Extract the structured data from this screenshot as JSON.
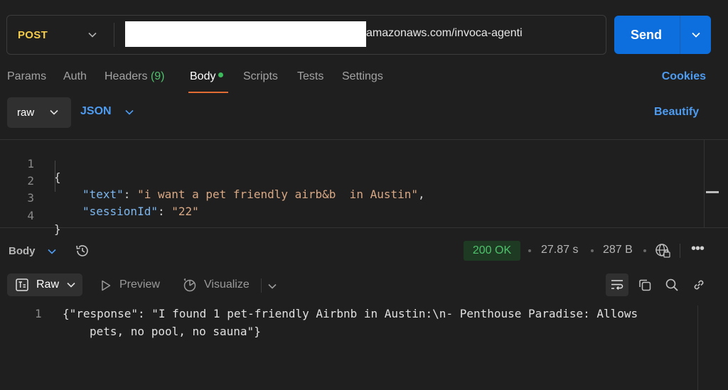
{
  "request": {
    "method": "POST",
    "url_visible": "amazonaws.com/invoca-agenti",
    "send_label": "Send"
  },
  "tabs": [
    {
      "label": "Params"
    },
    {
      "label": "Auth"
    },
    {
      "label": "Headers",
      "count": "(9)"
    },
    {
      "label": "Body",
      "active": true
    },
    {
      "label": "Scripts"
    },
    {
      "label": "Tests"
    },
    {
      "label": "Settings"
    }
  ],
  "cookies_label": "Cookies",
  "body_options": {
    "mode": "raw",
    "language": "JSON",
    "beautify_label": "Beautify"
  },
  "editor": {
    "line_numbers": [
      "1",
      "2",
      "3",
      "4"
    ],
    "open_brace": "{",
    "close_brace": "}",
    "text_key": "\"text\"",
    "text_value": "\"i want a pet friendly airb&b  in Austin\"",
    "session_key": "\"sessionId\"",
    "session_value": "\"22\""
  },
  "response": {
    "section_label": "Body",
    "status": "200 OK",
    "time": "27.87 s",
    "size": "287 B",
    "more_label": "•••",
    "view_mode": "Raw",
    "preview_label": "Preview",
    "visualize_label": "Visualize",
    "line_number": "1",
    "line_1": "{\"response\": \"I found 1 pet-friendly Airbnb in Austin:\\n- Penthouse Paradise: Allows",
    "line_1_wrap": "pets, no pool, no sauna\"}"
  },
  "colors": {
    "background": "#1f1f1f",
    "accent_blue": "#0d6fde",
    "method_yellow": "#f4cc4c",
    "status_green": "#4ec26b",
    "tab_underline": "#e06c34"
  },
  "icons": [
    "chevron-down-icon",
    "history-icon",
    "globe-icon",
    "raw-doc-icon",
    "play-icon",
    "visualize-icon",
    "wrap-icon",
    "copy-icon",
    "search-icon",
    "link-icon"
  ]
}
